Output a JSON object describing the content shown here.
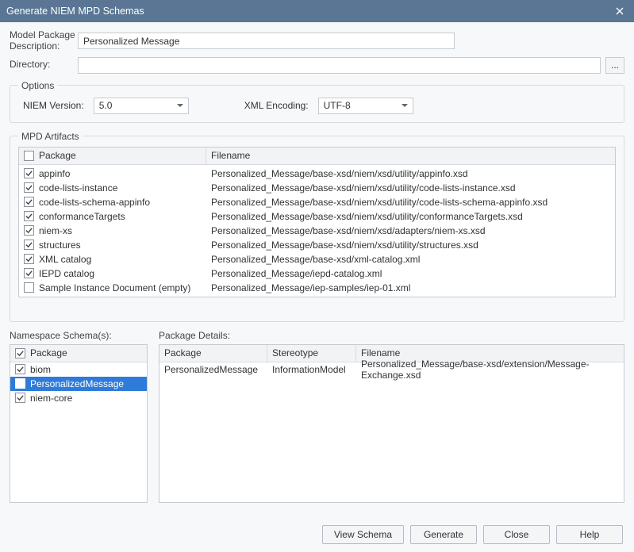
{
  "window": {
    "title": "Generate NIEM MPD Schemas"
  },
  "form": {
    "model_package_description_label": "Model Package\nDescription:",
    "model_package_description_value": "Personalized Message",
    "directory_label": "Directory:",
    "directory_value": "",
    "browse_label": "..."
  },
  "options": {
    "legend": "Options",
    "niem_version_label": "NIEM Version:",
    "niem_version_value": "5.0",
    "xml_encoding_label": "XML Encoding:",
    "xml_encoding_value": "UTF-8"
  },
  "artifacts": {
    "legend": "MPD Artifacts",
    "header_package": "Package",
    "header_filename": "Filename",
    "rows": [
      {
        "checked": true,
        "package": "appinfo",
        "filename": "Personalized_Message/base-xsd/niem/xsd/utility/appinfo.xsd"
      },
      {
        "checked": true,
        "package": "code-lists-instance",
        "filename": "Personalized_Message/base-xsd/niem/xsd/utility/code-lists-instance.xsd"
      },
      {
        "checked": true,
        "package": "code-lists-schema-appinfo",
        "filename": "Personalized_Message/base-xsd/niem/xsd/utility/code-lists-schema-appinfo.xsd"
      },
      {
        "checked": true,
        "package": "conformanceTargets",
        "filename": "Personalized_Message/base-xsd/niem/xsd/utility/conformanceTargets.xsd"
      },
      {
        "checked": true,
        "package": "niem-xs",
        "filename": "Personalized_Message/base-xsd/niem/xsd/adapters/niem-xs.xsd"
      },
      {
        "checked": true,
        "package": "structures",
        "filename": "Personalized_Message/base-xsd/niem/xsd/utility/structures.xsd"
      },
      {
        "checked": true,
        "package": "XML catalog",
        "filename": "Personalized_Message/base-xsd/xml-catalog.xml"
      },
      {
        "checked": true,
        "package": "IEPD catalog",
        "filename": "Personalized_Message/iepd-catalog.xml"
      },
      {
        "checked": false,
        "package": "Sample Instance Document (empty)",
        "filename": "Personalized_Message/iep-samples/iep-01.xml"
      }
    ]
  },
  "namespace": {
    "section_label": "Namespace Schema(s):",
    "header_package": "Package",
    "rows": [
      {
        "checked": true,
        "selected": false,
        "package": "biom"
      },
      {
        "checked": true,
        "selected": true,
        "package": "PersonalizedMessage"
      },
      {
        "checked": true,
        "selected": false,
        "package": "niem-core"
      }
    ]
  },
  "details": {
    "section_label": "Package Details:",
    "header_package": "Package",
    "header_stereotype": "Stereotype",
    "header_filename": "Filename",
    "rows": [
      {
        "package": "PersonalizedMessage",
        "stereotype": "InformationModel",
        "filename": "Personalized_Message/base-xsd/extension/Message-Exchange.xsd"
      }
    ]
  },
  "buttons": {
    "view_schema": "View Schema",
    "generate": "Generate",
    "close": "Close",
    "help": "Help"
  }
}
